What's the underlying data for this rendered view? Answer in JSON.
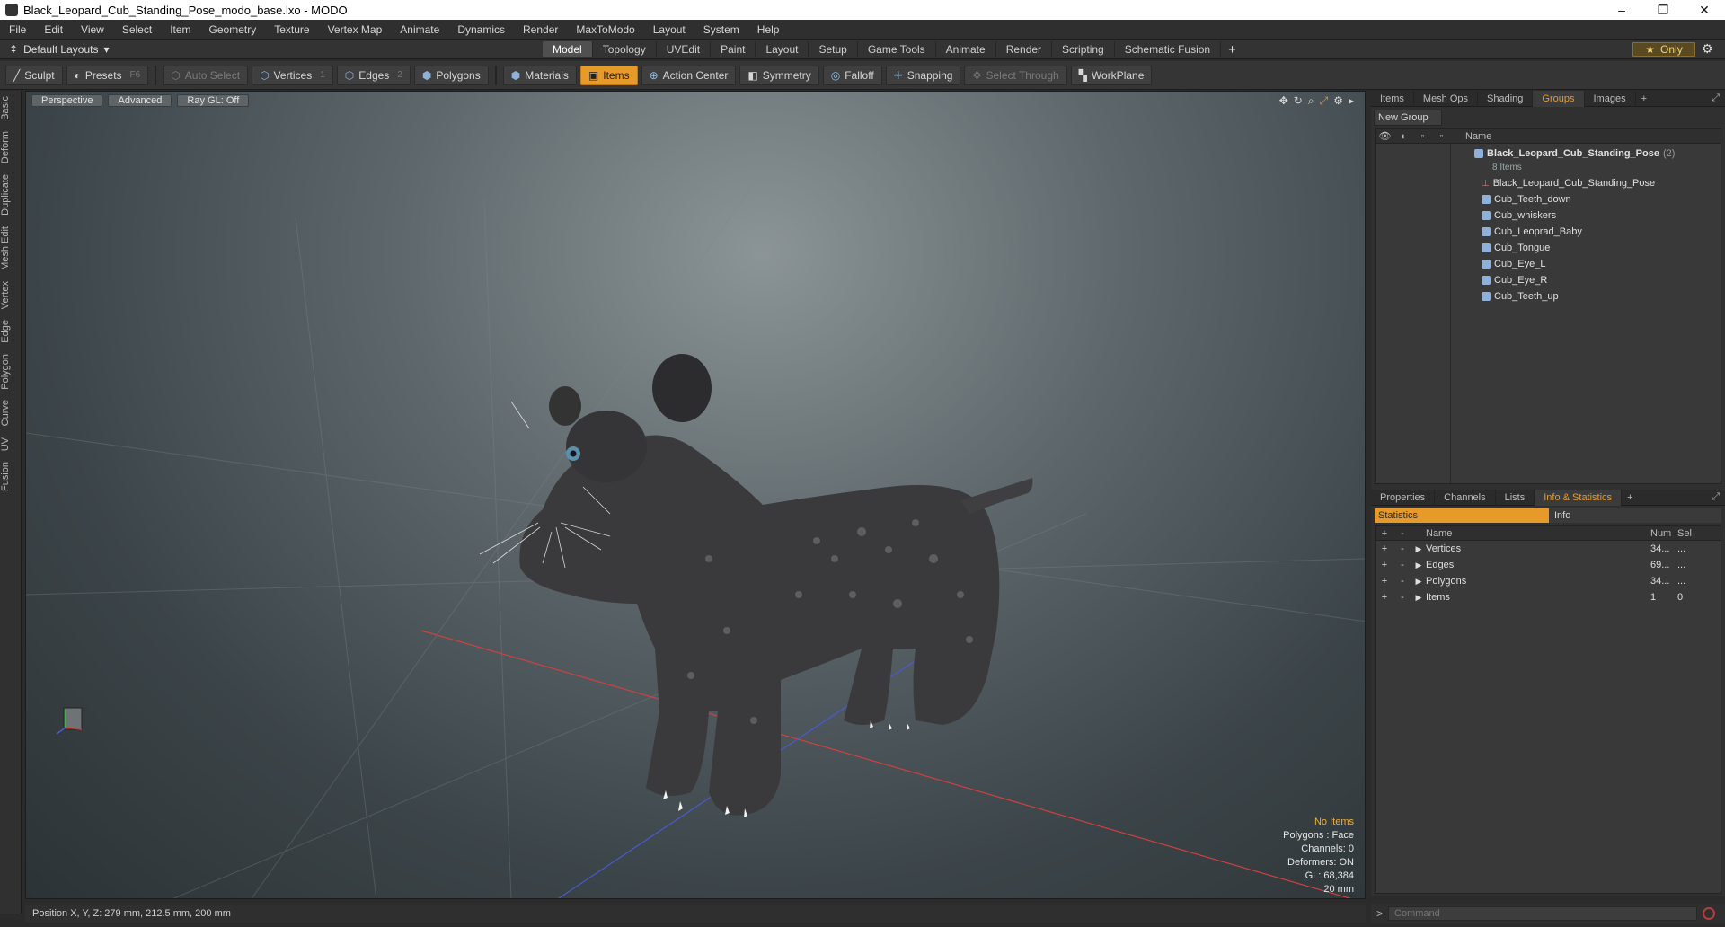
{
  "window": {
    "title": "Black_Leopard_Cub_Standing_Pose_modo_base.lxo - MODO",
    "minimize": "–",
    "maximize": "❐",
    "close": "✕"
  },
  "menu": [
    "File",
    "Edit",
    "View",
    "Select",
    "Item",
    "Geometry",
    "Texture",
    "Vertex Map",
    "Animate",
    "Dynamics",
    "Render",
    "MaxToModo",
    "Layout",
    "System",
    "Help"
  ],
  "layouts": {
    "label": "Default Layouts",
    "tabs": [
      "Model",
      "Topology",
      "UVEdit",
      "Paint",
      "Layout",
      "Setup",
      "Game Tools",
      "Animate",
      "Render",
      "Scripting",
      "Schematic Fusion"
    ],
    "active": "Model",
    "plus": "+",
    "only": "Only"
  },
  "toolbar": {
    "sculpt": "Sculpt",
    "presets": "Presets",
    "presets_key": "F6",
    "auto_select": "Auto Select",
    "vertices": "Vertices",
    "vertices_key": "1",
    "edges": "Edges",
    "edges_key": "2",
    "polygons": "Polygons",
    "materials": "Materials",
    "items": "Items",
    "action_center": "Action Center",
    "symmetry": "Symmetry",
    "falloff": "Falloff",
    "snapping": "Snapping",
    "select_through": "Select Through",
    "workplane": "WorkPlane"
  },
  "leftbar": [
    "Basic",
    "Deform",
    "Duplicate",
    "Mesh Edit",
    "Vertex",
    "Edge",
    "Polygon",
    "Curve",
    "UV",
    "Fusion"
  ],
  "viewport": {
    "perspective": "Perspective",
    "advanced": "Advanced",
    "raygl": "Ray GL: Off",
    "info": {
      "no_items": "No Items",
      "polygons": "Polygons : Face",
      "channels": "Channels: 0",
      "deformers": "Deformers: ON",
      "gl": "GL: 68,384",
      "scale": "20 mm"
    }
  },
  "status": "Position X, Y, Z:   279 mm, 212.5 mm, 200 mm",
  "groups_panel": {
    "tabs": [
      "Items",
      "Mesh Ops",
      "Shading",
      "Groups",
      "Images"
    ],
    "active": "Groups",
    "plus": "+",
    "new_group": "New Group",
    "col_name": "Name",
    "root": {
      "name": "Black_Leopard_Cub_Standing_Pose",
      "count": "(2)",
      "sub": "8 Items"
    },
    "children": [
      "Black_Leopard_Cub_Standing_Pose",
      "Cub_Teeth_down",
      "Cub_whiskers",
      "Cub_Leoprad_Baby",
      "Cub_Tongue",
      "Cub_Eye_L",
      "Cub_Eye_R",
      "Cub_Teeth_up"
    ]
  },
  "props_panel": {
    "tabs": [
      "Properties",
      "Channels",
      "Lists",
      "Info & Statistics"
    ],
    "active": "Info & Statistics",
    "plus": "+",
    "statistics": "Statistics",
    "info": "Info",
    "cols": {
      "plus": "+",
      "minus": "-",
      "name": "Name",
      "num": "Num",
      "sel": "Sel"
    },
    "rows": [
      {
        "name": "Vertices",
        "num": "34...",
        "sel": "..."
      },
      {
        "name": "Edges",
        "num": "69...",
        "sel": "..."
      },
      {
        "name": "Polygons",
        "num": "34...",
        "sel": "..."
      },
      {
        "name": "Items",
        "num": "1",
        "sel": "0"
      }
    ]
  },
  "command": {
    "prompt": ">",
    "placeholder": "Command"
  }
}
